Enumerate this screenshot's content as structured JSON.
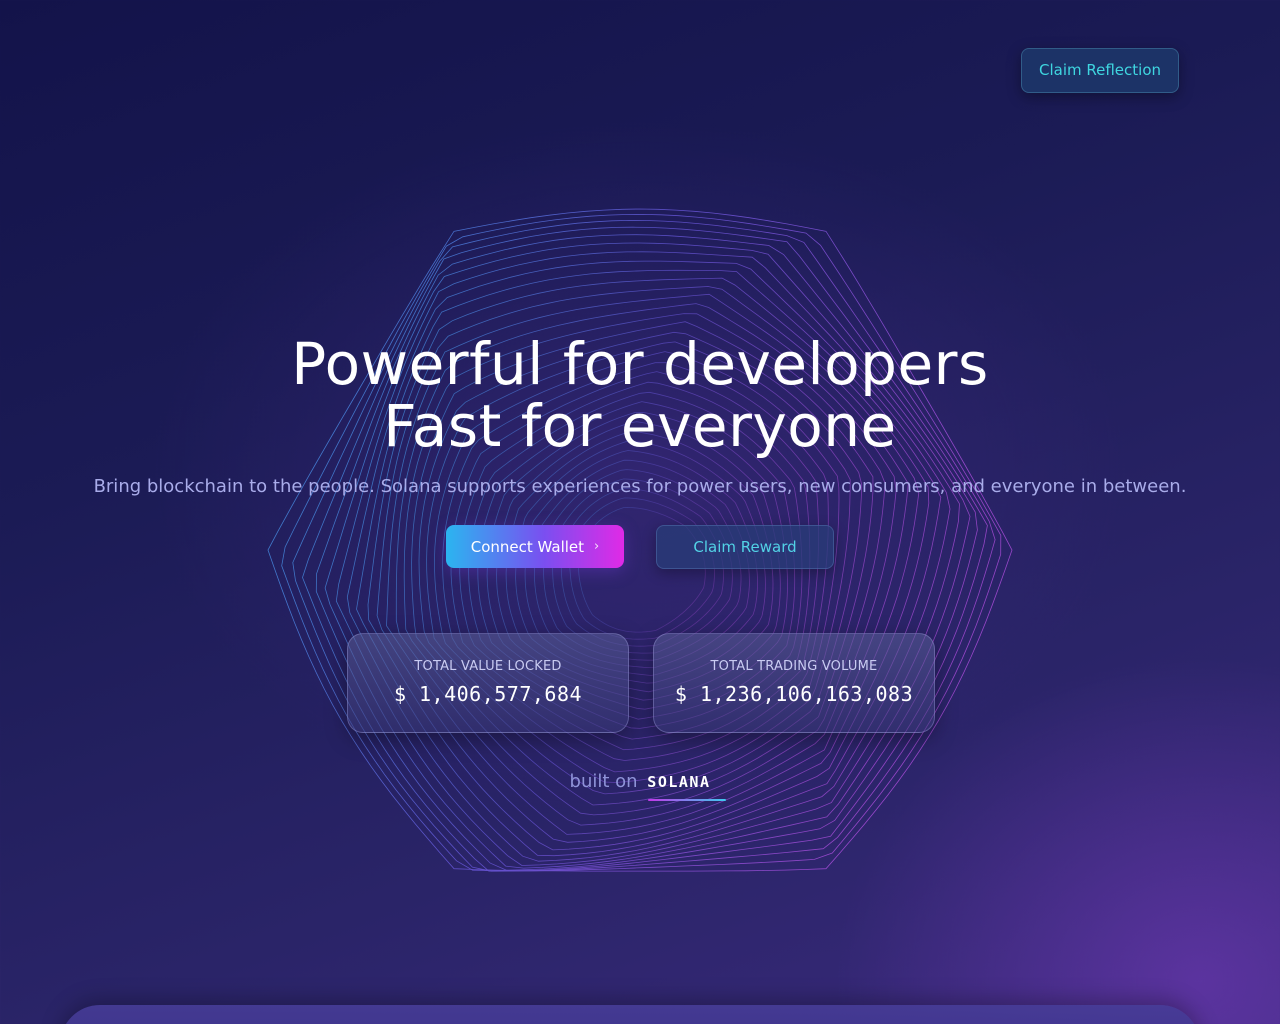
{
  "header": {
    "claim_reflection_label": "Claim Reflection"
  },
  "hero": {
    "title_line1": "Powerful for developers",
    "title_line2": "Fast for everyone",
    "subtitle": "Bring blockchain to the people. Solana supports experiences for power users, new consumers, and everyone in between."
  },
  "actions": {
    "connect_wallet_label": "Connect Wallet",
    "connect_wallet_icon": "chevron-right-icon",
    "claim_reward_label": "Claim Reward"
  },
  "stats": {
    "total_value_locked": {
      "label": "TOTAL VALUE LOCKED",
      "value": "$ 1,406,577,684"
    },
    "total_trading_volume": {
      "label": "TOTAL TRADING VOLUME",
      "value": "$ 1,236,106,163,083"
    }
  },
  "footer": {
    "built_on_text": "built on",
    "brand": "SOLANA"
  },
  "colors": {
    "accent_cyan": "#3fd6e0",
    "accent_magenta": "#e02ae6",
    "background_dark": "#13134a",
    "subtitle_text": "#a9acea"
  }
}
